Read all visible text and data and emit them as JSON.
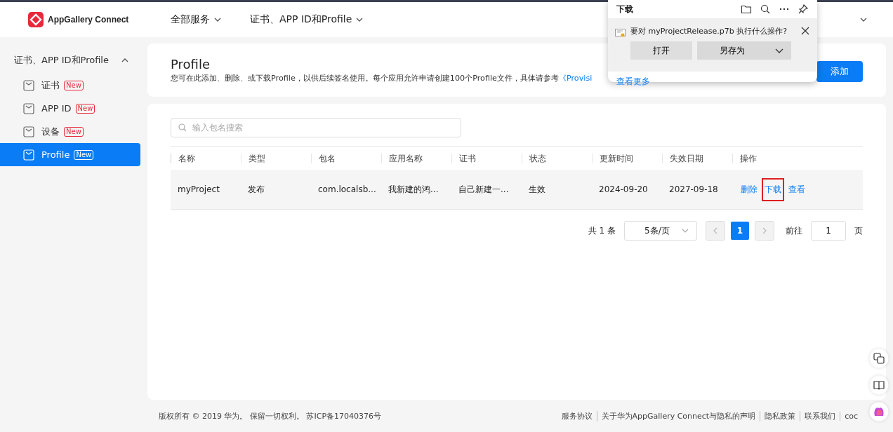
{
  "header": {
    "logo_text": "AppGallery Connect",
    "nav": [
      {
        "label": "全部服务"
      },
      {
        "label": "证书、APP ID和Profile"
      }
    ]
  },
  "sidebar": {
    "group": {
      "label": "证书、APP ID和Profile",
      "expanded": true
    },
    "items": [
      {
        "label": "证书",
        "badge": "New",
        "selected": false
      },
      {
        "label": "APP ID",
        "badge": "New",
        "selected": false
      },
      {
        "label": "设备",
        "badge": "New",
        "selected": false
      },
      {
        "label": "Profile",
        "badge": "New",
        "selected": true
      }
    ]
  },
  "page": {
    "title": "Profile",
    "description": "您可在此添加、删除、或下载Profile，以供后续签名使用。每个应用允许申请创建100个Profile文件，具体请参考",
    "link": "《Provisi",
    "add_button": "添加"
  },
  "search": {
    "placeholder": "输入包名搜索"
  },
  "table": {
    "columns": [
      "名称",
      "类型",
      "包名",
      "应用名称",
      "证书",
      "状态",
      "更新时间",
      "失效日期",
      "操作"
    ],
    "rows": [
      {
        "cells": [
          "myProject",
          "发布",
          "com.localsb...",
          "我新建的鸿...",
          "自己新建一...",
          "生效",
          "2024-09-20",
          "2027-09-18"
        ],
        "actions": [
          {
            "label": "删除",
            "highlighted": false
          },
          {
            "label": "下载",
            "highlighted": true
          },
          {
            "label": "查看",
            "highlighted": false
          }
        ]
      }
    ]
  },
  "pagination": {
    "total": "共 1 条",
    "page_size": "5条/页",
    "pages": [
      {
        "label": "1",
        "selected": true
      }
    ],
    "goto_label": "前往",
    "goto_value": "1",
    "goto_suffix": "页"
  },
  "footer": {
    "copyright": "版权所有 © 2019 华为。 保留一切权利。 苏ICP备17040376号",
    "links": [
      "服务协议",
      "关于华为AppGallery Connect与隐私的声明",
      "隐私政策",
      "联系我们",
      "coc"
    ]
  },
  "download_panel": {
    "title": "下载",
    "prompt": "要对 myProjectRelease.p7b 执行什么操作?",
    "buttons": [
      "打开",
      "另存为"
    ],
    "more_link": "查看更多"
  }
}
